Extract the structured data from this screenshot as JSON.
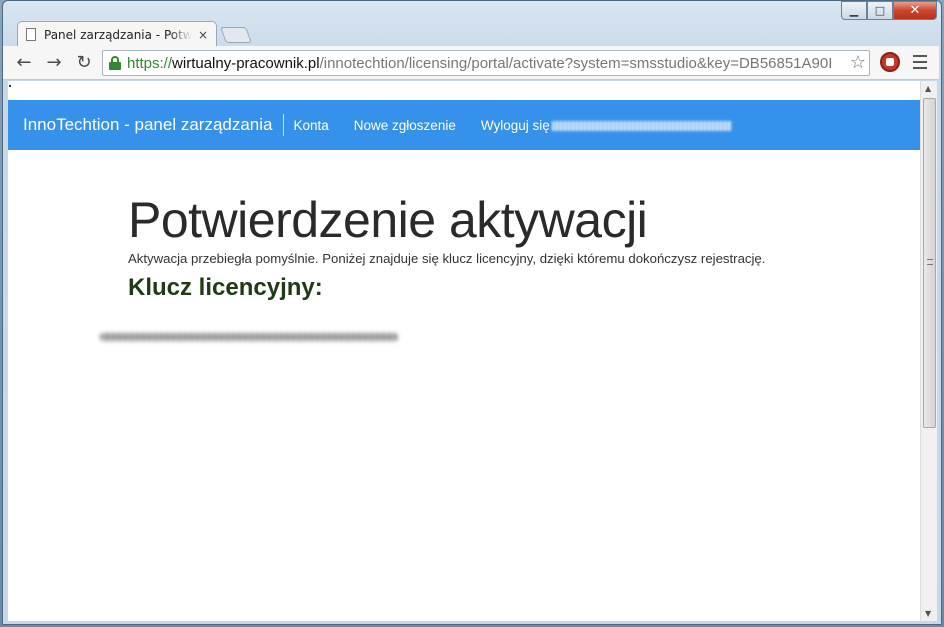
{
  "browser": {
    "tab_title": "Panel zarządzania - Potwierdzenie aktywacji",
    "tab_close": "×",
    "url": {
      "scheme": "https://",
      "host": "wirtualny-pracownik.pl",
      "path": "/innotechtion/licensing/portal/activate?system=smsstudio&key=DB56851A90I"
    },
    "back": "←",
    "forward": "→",
    "reload": "↻",
    "star": "☆",
    "minimize": "▁",
    "maximize": "□",
    "close": "✕"
  },
  "navbar": {
    "brand": "InnoTechtion - panel zarządzania",
    "links": [
      "Konta",
      "Nowe zgłoszenie",
      "Wyloguj się"
    ],
    "color": "#3591ea"
  },
  "content": {
    "title": "Potwierdzenie aktywacji",
    "description": "Aktywacja przebiegła pomyślnie. Poniżej znajduje się klucz licencyjny, dzięki któremu dokończysz rejestrację.",
    "license_heading": "Klucz licencyjny:"
  }
}
